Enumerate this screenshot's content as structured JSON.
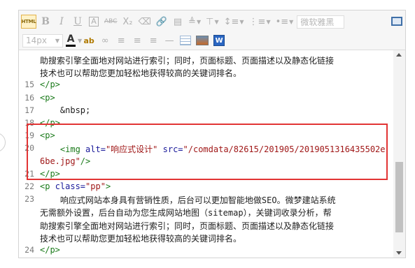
{
  "toolbar": {
    "html_label": "HTML",
    "bold_label": "B",
    "italic_label": "I",
    "underline_label": "U",
    "border_label": "A",
    "strike_label": "ABC",
    "subscript_label": "X₂",
    "font_family_placeholder": "微软雅黑",
    "font_size_value": "14px",
    "font_color_label": "A",
    "highlight_label": "ab",
    "word_label": "W"
  },
  "code_lines": [
    {
      "num": "",
      "parts": [
        {
          "cls": "txt",
          "text": "助搜索引擎全面地对网站进行索引；同时，页面标题、页面描述以及静态化链接"
        }
      ]
    },
    {
      "num": "",
      "parts": [
        {
          "cls": "txt",
          "text": "技术也可以帮助您更加轻松地获得较高的关键词排名。"
        }
      ]
    },
    {
      "num": "15",
      "parts": [
        {
          "cls": "tag",
          "text": "</p>"
        }
      ]
    },
    {
      "num": "16",
      "parts": [
        {
          "cls": "tag",
          "text": "<p>"
        }
      ]
    },
    {
      "num": "17",
      "parts": [
        {
          "cls": "txt",
          "text": "    &nbsp;"
        }
      ]
    },
    {
      "num": "18",
      "parts": [
        {
          "cls": "tag",
          "text": "</p>"
        }
      ]
    },
    {
      "num": "19",
      "parts": [
        {
          "cls": "tag",
          "text": "<p>"
        }
      ]
    },
    {
      "num": "20",
      "parts": [
        {
          "cls": "tag",
          "text": "    <img "
        },
        {
          "cls": "attr",
          "text": "alt="
        },
        {
          "cls": "str",
          "text": "\"响应式设计\""
        },
        {
          "cls": "attr",
          "text": " src="
        },
        {
          "cls": "str",
          "text": "\"/comdata/82615/201905/2019051316435502e"
        }
      ]
    },
    {
      "num": "",
      "parts": [
        {
          "cls": "str",
          "text": "6be.jpg\""
        },
        {
          "cls": "tag",
          "text": "/>"
        }
      ]
    },
    {
      "num": "21",
      "parts": [
        {
          "cls": "tag",
          "text": "</p>"
        }
      ]
    },
    {
      "num": "22",
      "parts": [
        {
          "cls": "tag",
          "text": "<p "
        },
        {
          "cls": "attr",
          "text": "class="
        },
        {
          "cls": "str",
          "text": "\"pp\""
        },
        {
          "cls": "tag",
          "text": ">"
        }
      ]
    },
    {
      "num": "23",
      "parts": [
        {
          "cls": "txt",
          "text": "    响应式网站本身具有营销性质，后台可以更加智能地做SEO。微梦建站系统"
        }
      ]
    },
    {
      "num": "",
      "parts": [
        {
          "cls": "txt",
          "text": "无需额外设置，后台自动为您生成网站地图（sitemap），关键词收录分析，帮"
        }
      ]
    },
    {
      "num": "",
      "parts": [
        {
          "cls": "txt",
          "text": "助搜索引擎全面地对网站进行索引；同时，页面标题、页面描述以及静态化链接"
        }
      ]
    },
    {
      "num": "",
      "parts": [
        {
          "cls": "txt",
          "text": "技术也可以帮助您更加轻松地获得较高的关键词排名。"
        }
      ]
    },
    {
      "num": "24",
      "parts": [
        {
          "cls": "tag",
          "text": "</p>"
        }
      ]
    }
  ]
}
